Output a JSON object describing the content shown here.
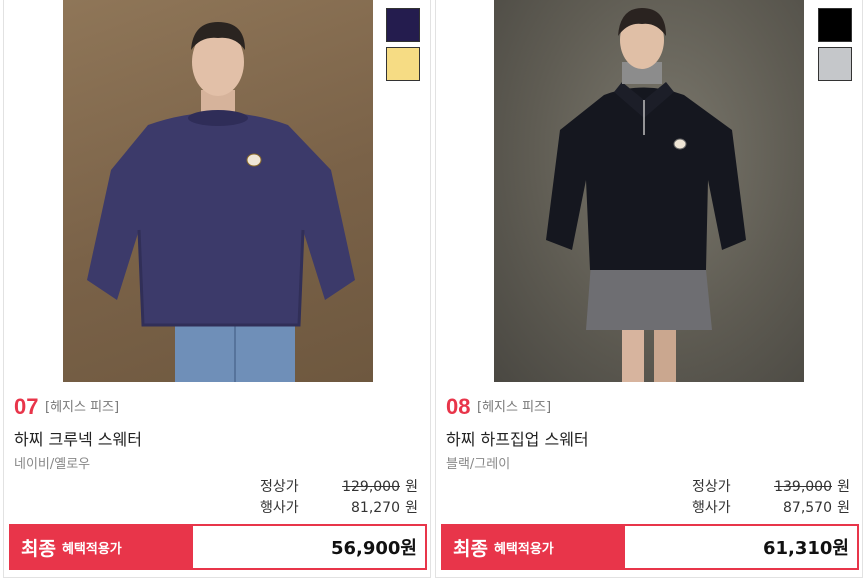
{
  "products": [
    {
      "number": "07",
      "brand": "[헤지스 피즈]",
      "name": "하찌 크루넥 스웨터",
      "color_text": "네이비/옐로우",
      "image": "model-navy-crewneck-sweater",
      "swatches": [
        "#241c4e",
        "#f6dc84"
      ],
      "regular_label": "정상가",
      "regular_price": "129,000",
      "event_label": "행사가",
      "event_price": "81,270",
      "won": "원",
      "final_big": "최종",
      "final_small": "혜택적용가",
      "final_price": "56,900원"
    },
    {
      "number": "08",
      "brand": "[헤지스 피즈]",
      "name": "하찌 하프집업 스웨터",
      "color_text": "블랙/그레이",
      "image": "model-black-halfzip-sweater",
      "swatches": [
        "#000000",
        "#c5c7ca"
      ],
      "regular_label": "정상가",
      "regular_price": "139,000",
      "event_label": "행사가",
      "event_price": "87,570",
      "won": "원",
      "final_big": "최종",
      "final_small": "혜택적용가",
      "final_price": "61,310원"
    }
  ],
  "colors": {
    "accent": "#e8354a",
    "border": "#e2e2e2"
  }
}
